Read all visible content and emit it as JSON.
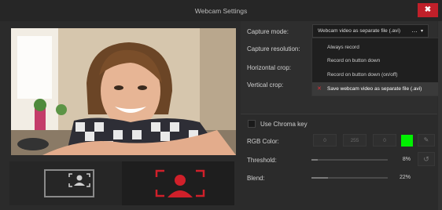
{
  "window": {
    "title": "Webcam Settings",
    "close_icon": "close-icon",
    "close_glyph": "✖"
  },
  "capture": {
    "mode_label": "Capture mode:",
    "mode_value": "Webcam video as separate file (.avi)",
    "more_glyph": "…",
    "chevron_glyph": "▾",
    "resolution_label": "Capture resolution:",
    "horizontal_crop_label": "Horizontal crop:",
    "vertical_crop_label": "Vertical crop:"
  },
  "dropdown": {
    "items": [
      {
        "label": "Always record",
        "selected": false
      },
      {
        "label": "Record on button down",
        "selected": false
      },
      {
        "label": "Record on button down (on/off)",
        "selected": false
      },
      {
        "label": "Save webcam video as separate file (.avi)",
        "selected": true
      }
    ],
    "selected_mark": "✕"
  },
  "chroma": {
    "checkbox_label": "Use Chroma key",
    "checked": false,
    "rgb_label": "RGB Color:",
    "r": "0",
    "g": "255",
    "b": "0",
    "swatch_color": "#00f000",
    "picker_icon": "eyedropper-icon",
    "picker_glyph": "✎",
    "threshold_label": "Threshold:",
    "threshold_value": "8%",
    "threshold_level": 0.08,
    "reset_icon": "reset-icon",
    "reset_glyph": "↺",
    "blend_label": "Blend:",
    "blend_value": "22%",
    "blend_level": 0.22
  },
  "modes": {
    "left_icon": "webcam-small-frame-icon",
    "right_icon": "webcam-full-frame-icon",
    "active": "right",
    "accent": "#d0202a"
  }
}
